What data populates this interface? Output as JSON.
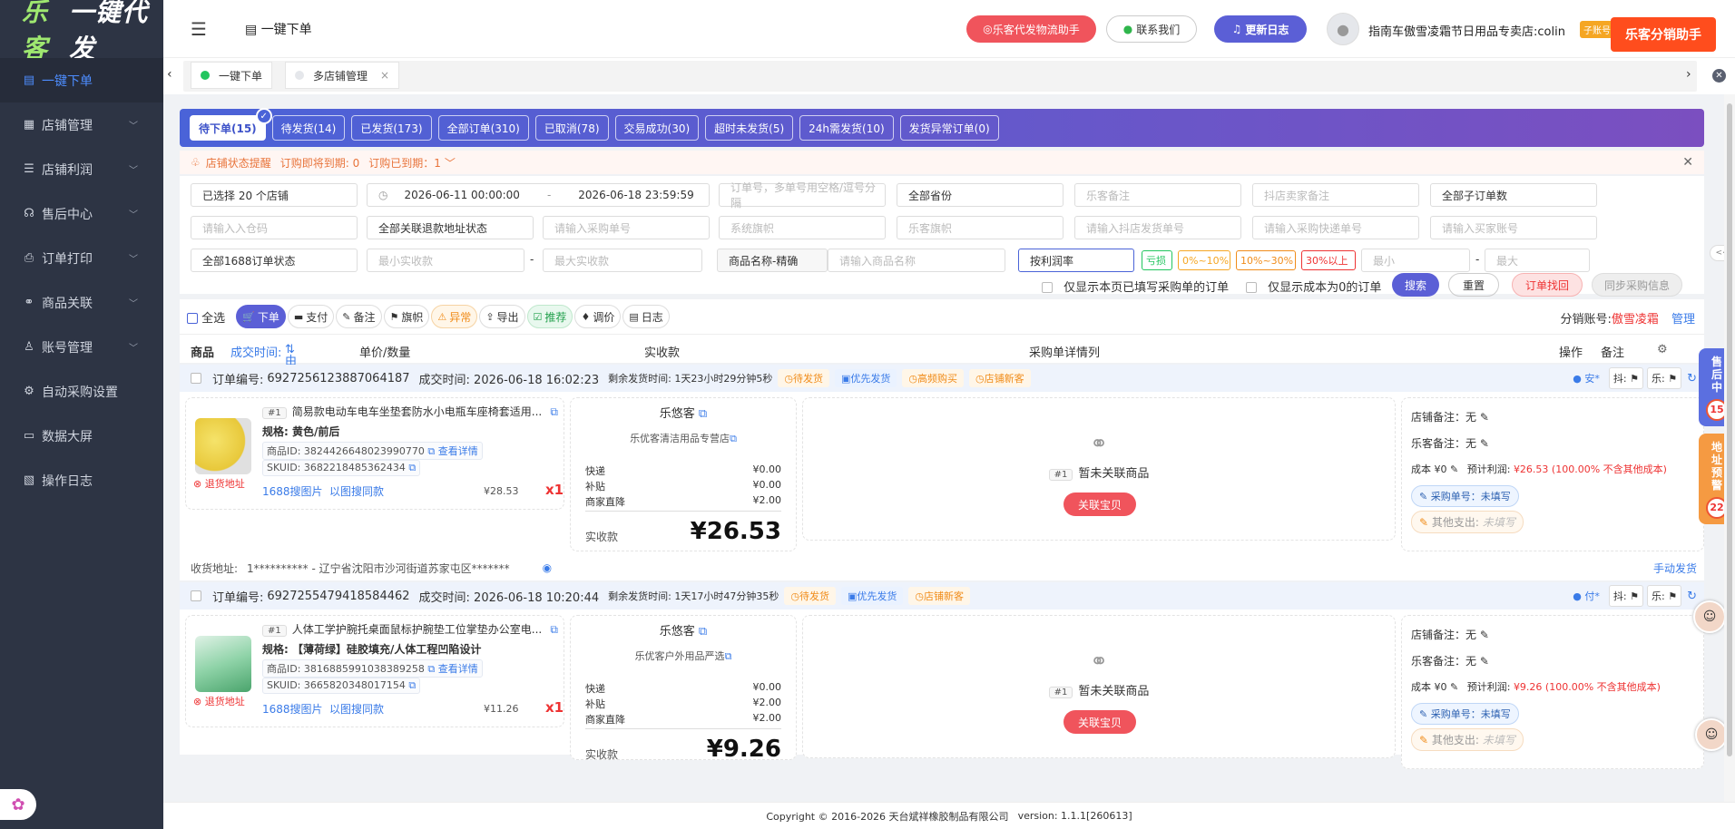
{
  "app": {
    "logo_a": "乐客",
    "logo_b": "一键代发"
  },
  "sidebar": {
    "items": [
      {
        "label": "一键下单",
        "icon": "clipboard-icon",
        "chev": false
      },
      {
        "label": "店铺管理",
        "icon": "shop-icon",
        "chev": true
      },
      {
        "label": "店铺利润",
        "icon": "database-icon",
        "chev": true
      },
      {
        "label": "售后中心",
        "icon": "headset-icon",
        "chev": true
      },
      {
        "label": "订单打印",
        "icon": "printer-icon",
        "chev": true
      },
      {
        "label": "商品关联",
        "icon": "link-icon",
        "chev": true
      },
      {
        "label": "账号管理",
        "icon": "user-icon",
        "chev": true
      },
      {
        "label": "自动采购设置",
        "icon": "gear-icon",
        "chev": false
      },
      {
        "label": "数据大屏",
        "icon": "monitor-icon",
        "chev": false
      },
      {
        "label": "操作日志",
        "icon": "document-icon",
        "chev": false
      }
    ]
  },
  "header": {
    "breadcrumb": "一键下单",
    "btn_logistics": "乐客代发物流助手",
    "btn_contact": "联系我们",
    "btn_changelog": "更新日志",
    "shop_name": "指南车傲雪凌霜节日用品专卖店:colin",
    "sub_account": "子账号",
    "fx_helper": "乐客分销助手"
  },
  "tabs": [
    {
      "label": "一键下单",
      "active": true
    },
    {
      "label": "多店铺管理",
      "active": false
    }
  ],
  "status_tabs": [
    "待下单(15)",
    "待发货(14)",
    "已发货(173)",
    "全部订单(310)",
    "已取消(78)",
    "交易成功(30)",
    "超时未发货(5)",
    "24h需发货(10)",
    "发货异常订单(0)"
  ],
  "alert": {
    "text": "店铺状态提醒",
    "expiring": "订购即将到期: 0",
    "expired": "订购已到期：1"
  },
  "filters": {
    "shops": "已选择 20 个店铺",
    "date_start": "2026-06-11 00:00:00",
    "date_sep": "-",
    "date_end": "2026-06-18 23:59:59",
    "order_no_ph": "订单号，多单号用空格/逗号分隔",
    "province": "全部省份",
    "leke_note_ph": "乐客备注",
    "seller_note_ph": "抖店卖家备注",
    "sub_orders": "全部子订单数",
    "warehouse_ph": "请输入入仓码",
    "refund_status": "全部关联退款地址状态",
    "purchase_no_ph": "请输入采购单号",
    "sys_flag_ph": "系统旗帜",
    "leke_flag_ph": "乐客旗帜",
    "dy_ship_ph": "请输入抖店发货单号",
    "purchase_express_ph": "请输入采购快递单号",
    "buyer_ph": "请输入买家账号",
    "status_1688": "全部1688订单状态",
    "min_pay_ph": "最小实收款",
    "max_pay_ph": "最大实收款",
    "pay_sep": "-",
    "product_mode": "商品名称-精确",
    "product_name_ph": "请输入商品名称",
    "profit_sort": "按利润率",
    "chip_loss": "亏损",
    "chip_0_10": "0%~10%",
    "chip_10_30": "10%~30%",
    "chip_30": "30%以上",
    "min_ph": "最小",
    "max_ph": "最大",
    "profit_sep": "-",
    "only_filled": "仅显示本页已填写采购单的订单",
    "only_zero_cost": "仅显示成本为0的订单",
    "btn_search": "搜索",
    "btn_reset": "重置",
    "btn_retrieve": "订单找回",
    "btn_sync": "同步采购信息"
  },
  "toolbar": {
    "select_all": "全选",
    "actions": [
      {
        "label": "下单",
        "icon": "cart-icon"
      },
      {
        "label": "支付",
        "icon": "card-icon"
      },
      {
        "label": "备注",
        "icon": "note-icon"
      },
      {
        "label": "旗帜",
        "icon": "flag-icon"
      },
      {
        "label": "异常",
        "icon": "warning-icon"
      },
      {
        "label": "导出",
        "icon": "export-icon"
      },
      {
        "label": "推荐",
        "icon": "recommend-icon"
      },
      {
        "label": "调价",
        "icon": "price-icon"
      },
      {
        "label": "日志",
        "icon": "log-icon"
      }
    ],
    "fx_account_label": "分销账号:",
    "fx_account_value": "傲雪凌霜",
    "manage": "管理"
  },
  "columns": {
    "product": "商品",
    "deal_time": "成交时间:",
    "sort": "由近到远",
    "price_qty": "单价/数量",
    "paid": "实收款",
    "purchase": "采购单详情列",
    "ops": "操作",
    "note": "备注"
  },
  "orders": [
    {
      "order_no_label": "订单编号:",
      "order_no": "6927256123887064187",
      "deal_time": "成交时间: 2026-06-18 16:02:23",
      "remain": "剩余发货时间: 1天23小时29分钟5秒",
      "tags": [
        "待发货",
        "优先发货",
        "高频购买",
        "店铺新客"
      ],
      "tag_colors": [
        "orange",
        "blue",
        "orange",
        "orange"
      ],
      "buyer_mark": "安*",
      "flag_1": "抖:",
      "flag_2": "乐:",
      "index": "#1",
      "title": "简易款电动车电车坐垫套防水小电瓶车座椅套适用...",
      "spec": "规格: 黄色/前后",
      "product_id": "商品ID: 3824426648023990770",
      "view_detail": "查看详情",
      "skuid": "SKUID: 3682218485362434",
      "return_addr": "退货地址",
      "search_img": "1688搜图片",
      "same_img": "以图搜同款",
      "price": "¥28.53",
      "qty": "x1",
      "shop": "乐悠客",
      "store": "乐优客清洁用品专营店",
      "express_label": "快递",
      "express_val": "¥0.00",
      "subsidy_label": "补贴",
      "subsidy_val": "¥0.00",
      "discount_label": "商家直降",
      "discount_val": "¥2.00",
      "paid_label": "实收款",
      "paid_val": "¥26.53",
      "unlinked": "暂未关联商品",
      "link_btn": "关联宝贝",
      "shop_note": "店铺备注：无",
      "leke_note": "乐客备注：无",
      "cost": "成本 ¥0",
      "profit_label": "预计利润:",
      "profit": "¥26.53 (100.00% 不含其他成本)",
      "purchase_no": "采购单号：未填写",
      "other_cost": "其他支出:",
      "other_cost_val": "未填写",
      "address_label": "收货地址:",
      "address": "1********** - 辽宁省沈阳市沙河街道苏家屯区*******",
      "manual_ship": "手动发货"
    },
    {
      "order_no_label": "订单编号:",
      "order_no": "6927255479418584462",
      "deal_time": "成交时间: 2026-06-18 10:20:44",
      "remain": "剩余发货时间: 1天17小时47分钟35秒",
      "tags": [
        "待发货",
        "优先发货",
        "店铺新客"
      ],
      "tag_colors": [
        "orange",
        "blue",
        "orange"
      ],
      "buyer_mark": "付*",
      "flag_1": "抖:",
      "flag_2": "乐:",
      "index": "#1",
      "title": "人体工学护腕托桌面鼠标护腕垫工位掌垫办公室电...",
      "spec": "规格: 【薄荷绿】硅胶填充/人体工程凹陷设计",
      "product_id": "商品ID: 3816885991038389258",
      "view_detail": "查看详情",
      "skuid": "SKUID: 3665820348017154",
      "return_addr": "退货地址",
      "search_img": "1688搜图片",
      "same_img": "以图搜同款",
      "price": "¥11.26",
      "qty": "x1",
      "shop": "乐悠客",
      "store": "乐优客户外用品严选",
      "express_label": "快递",
      "express_val": "¥0.00",
      "subsidy_label": "补贴",
      "subsidy_val": "¥2.00",
      "discount_label": "商家直降",
      "discount_val": "¥2.00",
      "paid_label": "实收款",
      "paid_val": "¥9.26",
      "unlinked": "暂未关联商品",
      "link_btn": "关联宝贝",
      "shop_note": "店铺备注：无",
      "leke_note": "乐客备注：无",
      "cost": "成本 ¥0",
      "profit_label": "预计利润:",
      "profit": "¥9.26 (100.00% 不含其他成本)",
      "purchase_no": "采购单号：未填写",
      "other_cost": "其他支出:",
      "other_cost_val": "未填写"
    }
  ],
  "floats": {
    "after_sale": "售后中",
    "after_sale_count": "15",
    "addr_warn": "地址预警",
    "addr_warn_count": "22"
  },
  "footer": {
    "copyright": "Copyright © 2016-2026 天台斌祥橡胶制品有限公司",
    "version": "version: 1.1.1[260613]"
  },
  "colors": {
    "sidebar": "#2d3444",
    "accent": "#4a63d8",
    "danger": "#f0545c",
    "orange": "#ff4d1d"
  }
}
